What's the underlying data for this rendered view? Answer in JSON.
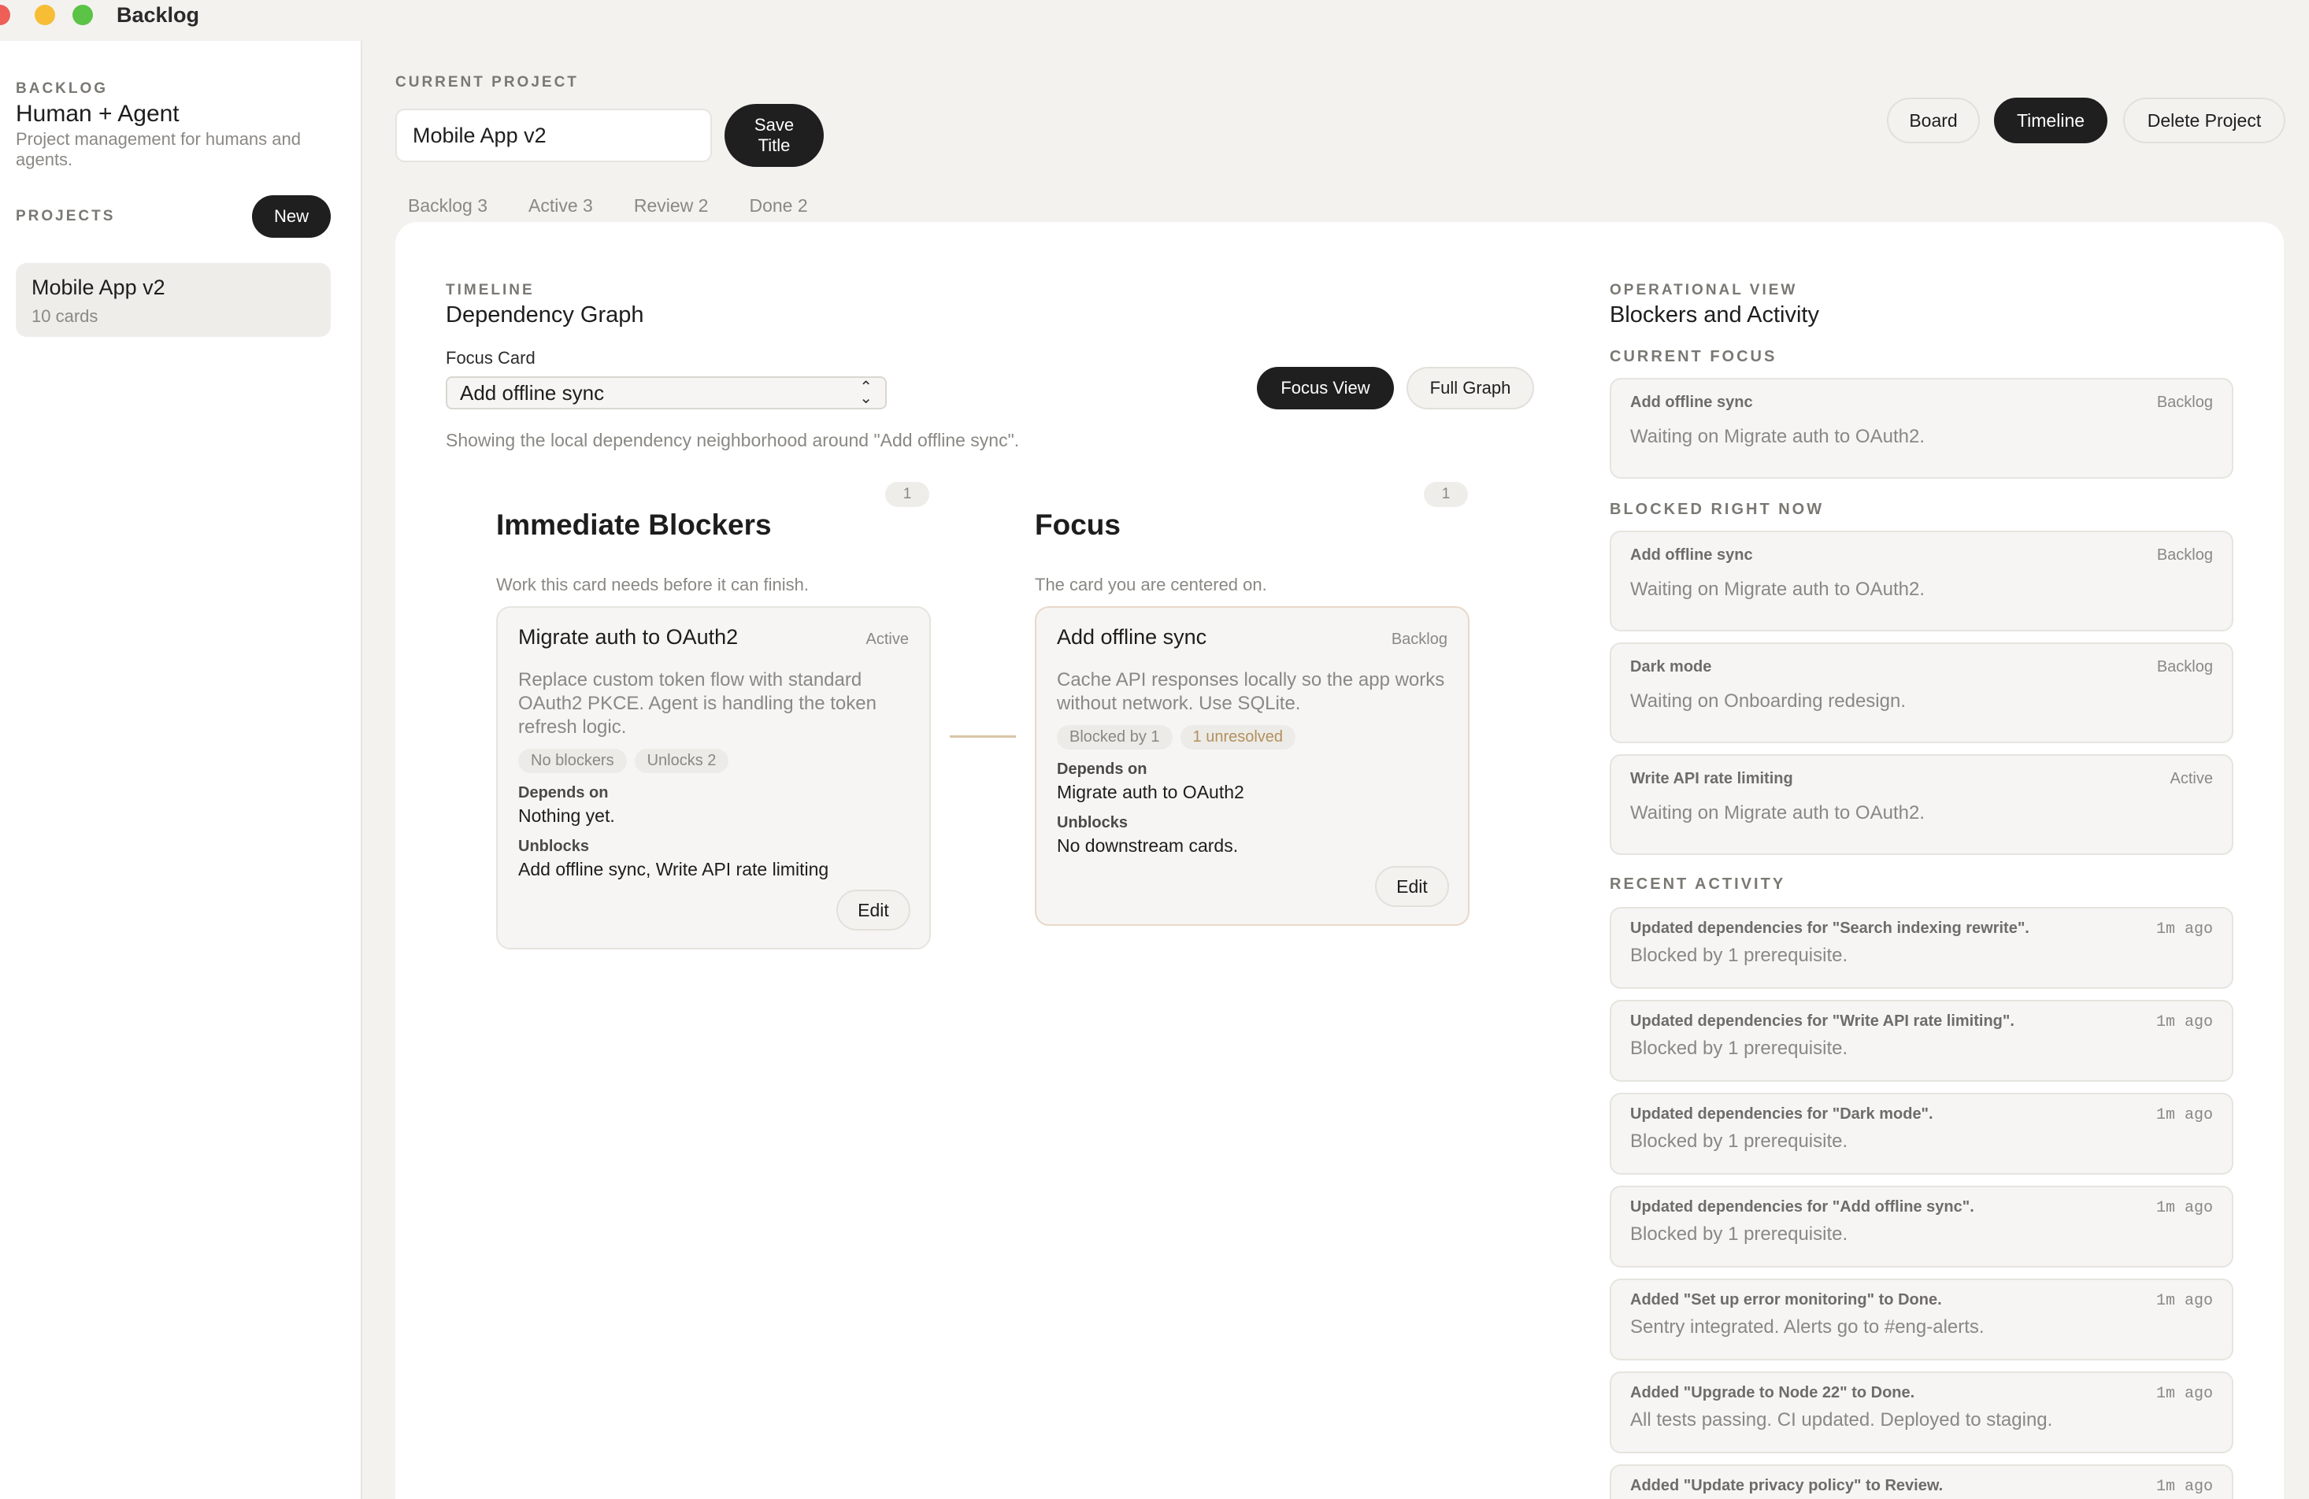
{
  "window": {
    "title": "Backlog"
  },
  "sidebar": {
    "eyebrow": "BACKLOG",
    "title": "Human + Agent",
    "subtitle": "Project management for humans and agents.",
    "projects_label": "PROJECTS",
    "new_label": "New",
    "projects": [
      {
        "name": "Mobile App v2",
        "count": "10 cards"
      }
    ]
  },
  "header": {
    "eyebrow": "CURRENT PROJECT",
    "project_title_value": "Mobile App v2",
    "save_title_line1": "Save",
    "save_title_line2": "Title",
    "board_label": "Board",
    "timeline_label": "Timeline",
    "delete_label": "Delete Project"
  },
  "tabs": [
    "Backlog 3",
    "Active 3",
    "Review 2",
    "Done 2"
  ],
  "timeline": {
    "eyebrow": "TIMELINE",
    "title": "Dependency Graph",
    "focus_card_label": "Focus Card",
    "focus_card_value": "Add offline sync",
    "focus_view_label": "Focus View",
    "full_graph_label": "Full Graph",
    "description": "Showing the local dependency neighborhood around \"Add offline sync\".",
    "columns": [
      {
        "count": "1",
        "title": "Immediate Blockers",
        "desc": "Work this card needs before it can finish.",
        "card": {
          "title": "Migrate auth to OAuth2",
          "status": "Active",
          "desc": "Replace custom token flow with standard OAuth2 PKCE. Agent is handling the token refresh logic.",
          "chips": [
            "No blockers",
            "Unlocks 2"
          ],
          "depends_label": "Depends on",
          "depends_value": "Nothing yet.",
          "unblocks_label": "Unblocks",
          "unblocks_value": "Add offline sync, Write API rate limiting",
          "edit_label": "Edit"
        }
      },
      {
        "count": "1",
        "title": "Focus",
        "desc": "The card you are centered on.",
        "card": {
          "title": "Add offline sync",
          "status": "Backlog",
          "desc": "Cache API responses locally so the app works without network. Use SQLite.",
          "chips": [
            "Blocked by 1",
            "1 unresolved"
          ],
          "depends_label": "Depends on",
          "depends_value": "Migrate auth to OAuth2",
          "unblocks_label": "Unblocks",
          "unblocks_value": "No downstream cards.",
          "edit_label": "Edit"
        }
      }
    ]
  },
  "operational": {
    "eyebrow": "OPERATIONAL VIEW",
    "title": "Blockers and Activity",
    "current_focus_label": "CURRENT FOCUS",
    "current_focus": {
      "title": "Add offline sync",
      "status": "Backlog",
      "body": "Waiting on Migrate auth to OAuth2."
    },
    "blocked_label": "BLOCKED RIGHT NOW",
    "blocked": [
      {
        "title": "Add offline sync",
        "status": "Backlog",
        "body": "Waiting on Migrate auth to OAuth2."
      },
      {
        "title": "Dark mode",
        "status": "Backlog",
        "body": "Waiting on Onboarding redesign."
      },
      {
        "title": "Write API rate limiting",
        "status": "Active",
        "body": "Waiting on Migrate auth to OAuth2."
      }
    ],
    "activity_label": "RECENT ACTIVITY",
    "activity": [
      {
        "title": "Updated dependencies for \"Search indexing rewrite\".",
        "time": "1m ago",
        "body": "Blocked by 1 prerequisite."
      },
      {
        "title": "Updated dependencies for \"Write API rate limiting\".",
        "time": "1m ago",
        "body": "Blocked by 1 prerequisite."
      },
      {
        "title": "Updated dependencies for \"Dark mode\".",
        "time": "1m ago",
        "body": "Blocked by 1 prerequisite."
      },
      {
        "title": "Updated dependencies for \"Add offline sync\".",
        "time": "1m ago",
        "body": "Blocked by 1 prerequisite."
      },
      {
        "title": "Added \"Set up error monitoring\" to Done.",
        "time": "1m ago",
        "body": "Sentry integrated. Alerts go to #eng-alerts."
      },
      {
        "title": "Added \"Upgrade to Node 22\" to Done.",
        "time": "1m ago",
        "body": "All tests passing. CI updated. Deployed to staging."
      },
      {
        "title": "Added \"Update privacy policy\" to Review.",
        "time": "1m ago",
        "body": ""
      }
    ]
  },
  "colors": {
    "accent_dark": "#1f1f1f",
    "connector": "#d8c6a8",
    "warn_chip": "#b3905c"
  }
}
